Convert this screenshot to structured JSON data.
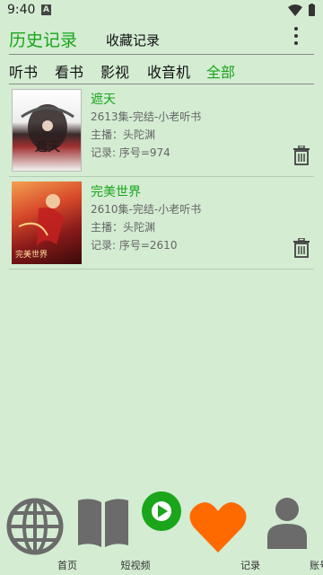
{
  "status": {
    "time": "9:40",
    "notif": "A"
  },
  "header": {
    "title": "历史记录",
    "tab2": "收藏记录"
  },
  "tabs": [
    "听书",
    "看书",
    "影视",
    "收音机",
    "全部"
  ],
  "records": [
    {
      "title": "遮天",
      "meta": "2613集-完结-小老听书",
      "host": "主播：头陀渊",
      "record": "记录: 序号=974",
      "cover_text": "遮天"
    },
    {
      "title": "完美世界",
      "meta": "2610集-完结-小老听书",
      "host": "主播：头陀渊",
      "record": "记录: 序号=2610",
      "cover_text": "完美世界"
    }
  ],
  "nav": [
    "首页",
    "短视频",
    "",
    "记录",
    "账号"
  ],
  "colors": {
    "accent": "#1aa51a",
    "heart": "#ff6a00",
    "background": "#d3ecd2",
    "icon_gray": "#6b6b6b"
  },
  "icons": {
    "more": "more-vert-icon",
    "delete": "trash-icon",
    "home": "globe-icon",
    "video": "book-icon",
    "play": "play-icon",
    "record": "heart-icon",
    "account": "person-icon"
  }
}
